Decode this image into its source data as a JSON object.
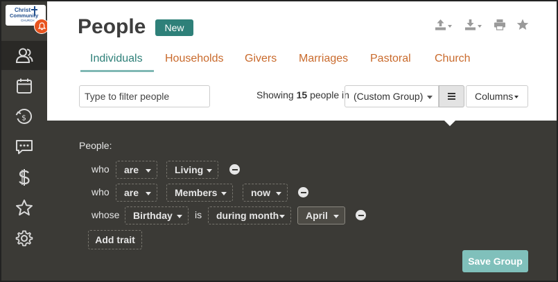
{
  "sidebar": {
    "logo": {
      "line1": "Christ",
      "line2": "Community",
      "line3": "CHURCH"
    },
    "items": [
      {
        "name": "people",
        "icon": "people-icon"
      },
      {
        "name": "calendar",
        "icon": "calendar-icon"
      },
      {
        "name": "giving",
        "icon": "giving-icon"
      },
      {
        "name": "messages",
        "icon": "chat-icon"
      },
      {
        "name": "finance",
        "icon": "dollar-icon"
      },
      {
        "name": "favorites",
        "icon": "star-icon"
      },
      {
        "name": "settings",
        "icon": "gear-icon"
      }
    ]
  },
  "header": {
    "title": "People",
    "badge": "New",
    "tabs": [
      {
        "label": "Individuals",
        "active": true
      },
      {
        "label": "Households"
      },
      {
        "label": "Givers"
      },
      {
        "label": "Marriages"
      },
      {
        "label": "Pastoral"
      },
      {
        "label": "Church"
      }
    ]
  },
  "toolbar": {
    "filter_placeholder": "Type to filter people",
    "showing_prefix": "Showing",
    "showing_count": "15",
    "showing_suffix": "people in",
    "group": "(Custom Group)",
    "columns_label": "Columns"
  },
  "query": {
    "label": "People:",
    "rows": [
      {
        "lead": "who",
        "a": "are",
        "b": "Living"
      },
      {
        "lead": "who",
        "a": "are",
        "b": "Members",
        "c": "now"
      },
      {
        "lead": "whose",
        "a": "Birthday",
        "joiner": "is",
        "b": "during month",
        "c": "April"
      }
    ],
    "add_trait": "Add trait",
    "save_label": "Save Group"
  },
  "colors": {
    "accent": "#2e8079",
    "tab": "#c96a2c",
    "dark_panel": "#3b3a36",
    "bell": "#e8541f",
    "save": "#80c0bb"
  }
}
